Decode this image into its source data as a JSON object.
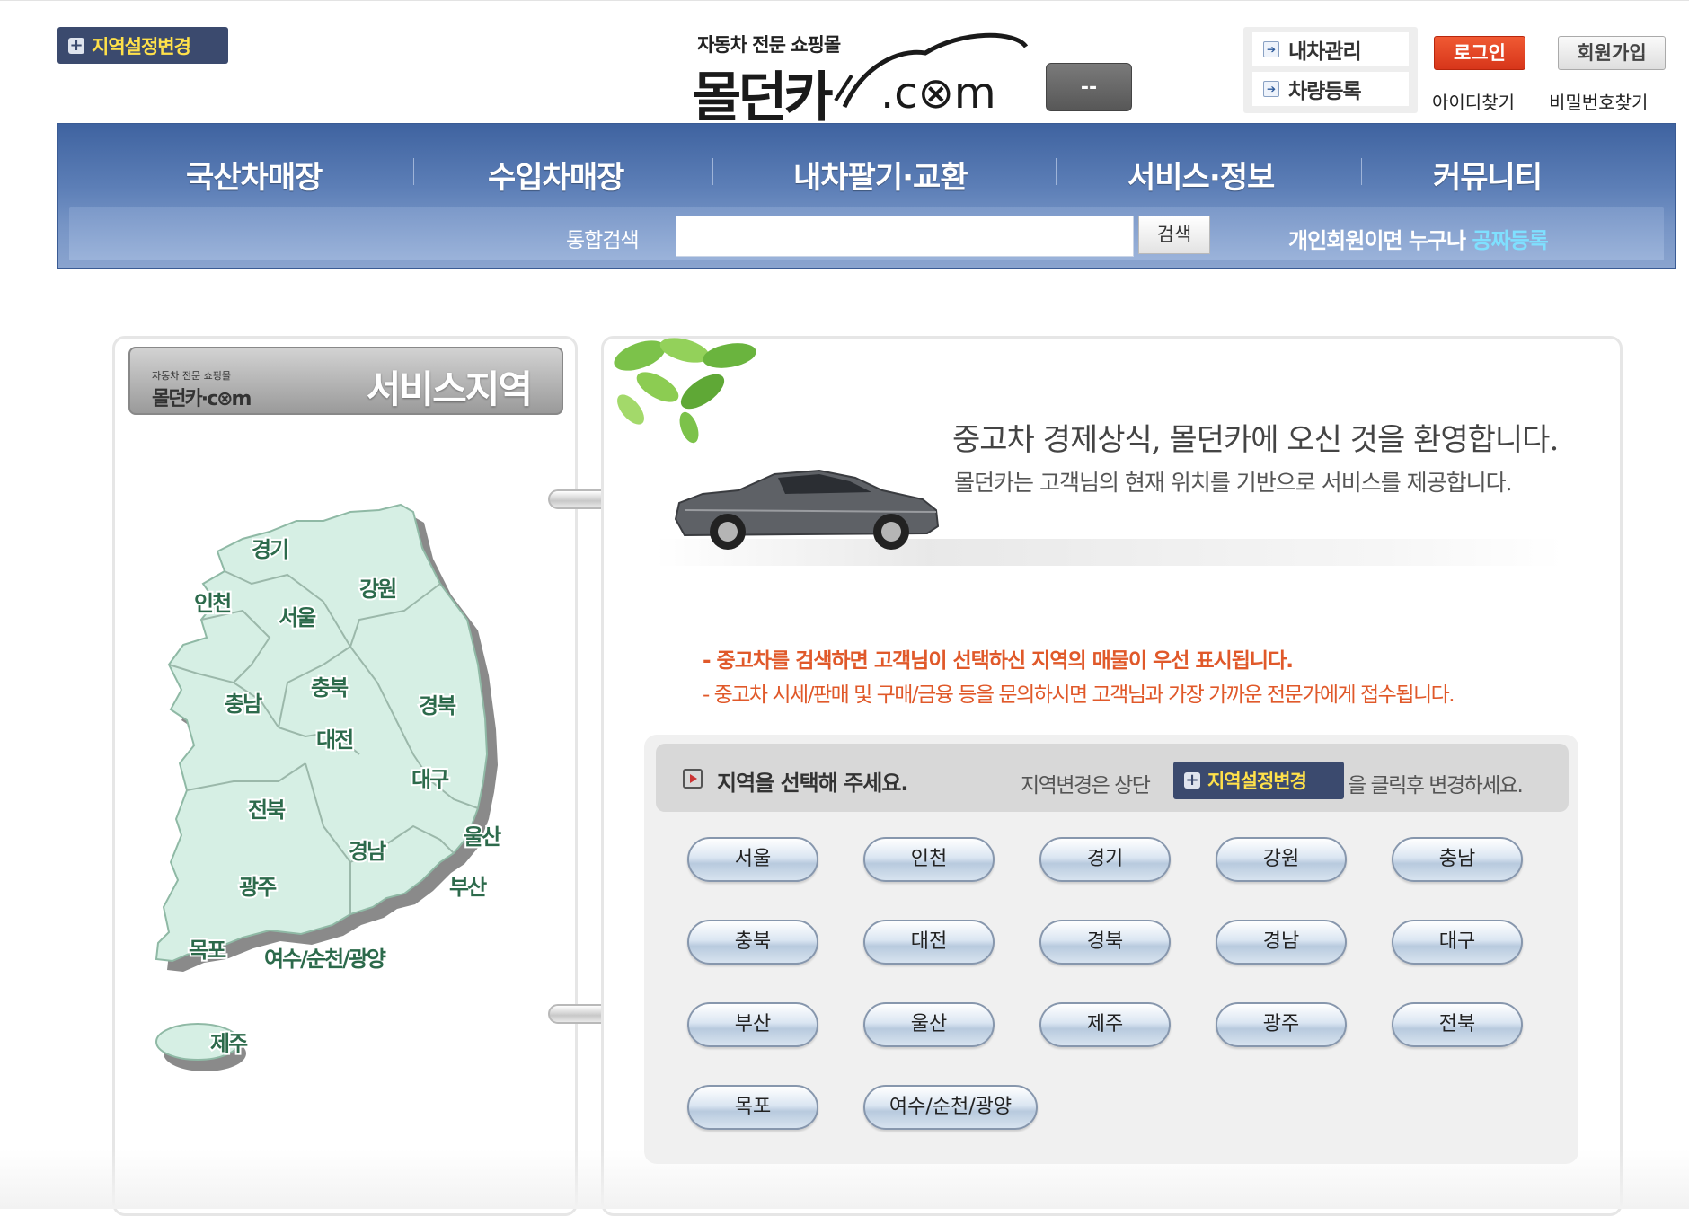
{
  "header": {
    "region_change_label": "지역설정변경",
    "logo_tagline": "자동차 전문 쇼핑몰",
    "logo_name": "몰던카",
    "logo_domain": ".c⊗m",
    "dash_button": "--",
    "my_car_manage": "내차관리",
    "car_register": "차량등록",
    "login": "로그인",
    "signup": "회원가입",
    "find_id": "아이디찾기",
    "find_password": "비밀번호찾기"
  },
  "nav": {
    "menus": [
      "국산차매장",
      "수입차매장",
      "내차팔기·교환",
      "서비스·정보",
      "커뮤니티"
    ],
    "search_label": "통합검색",
    "search_value": "",
    "search_button": "검색",
    "promo_text": "개인회원이면 누구나 ",
    "promo_highlight": "공짜등록"
  },
  "left_panel": {
    "mini_logo_tagline": "자동차 전문 쇼핑몰",
    "mini_logo": "몰던카·c⊗m",
    "title": "서비스지역",
    "map_regions": [
      "경기",
      "인천",
      "서울",
      "강원",
      "충남",
      "충북",
      "경북",
      "대전",
      "대구",
      "전북",
      "경남",
      "울산",
      "광주",
      "부산",
      "목포",
      "여수/순천/광양",
      "제주"
    ]
  },
  "right_panel": {
    "welcome_title": "중고차 경제상식, 몰던카에 오신 것을 환영합니다.",
    "welcome_sub": "몰던카는 고객님의 현재 위치를 기반으로 서비스를 제공합니다.",
    "notice_1": "- 중고차를 검색하면 고객님이 선택하신 지역의 매물이 우선  표시됩니다.",
    "notice_2": "- 중고차 시세/판매 및 구매/금융 등을 문의하시면 고객님과 가장 가까운 전문가에게 접수됩니다.",
    "select_title": "지역을 선택해 주세요.",
    "select_note_before": "지역변경은 상단",
    "select_note_button": "지역설정변경",
    "select_note_after": "을 클릭후 변경하세요.",
    "regions": [
      "서울",
      "인천",
      "경기",
      "강원",
      "충남",
      "충북",
      "대전",
      "경북",
      "경남",
      "대구",
      "부산",
      "울산",
      "제주",
      "광주",
      "전북",
      "목포",
      "여수/순천/광양"
    ]
  },
  "colors": {
    "nav_blue": "#4a6ca8",
    "region_btn_bg": "#3b4a6e",
    "region_btn_text": "#ffe14a",
    "login_red": "#e2441f",
    "notice_orange": "#e0592a",
    "map_fill": "#d6efe4"
  }
}
